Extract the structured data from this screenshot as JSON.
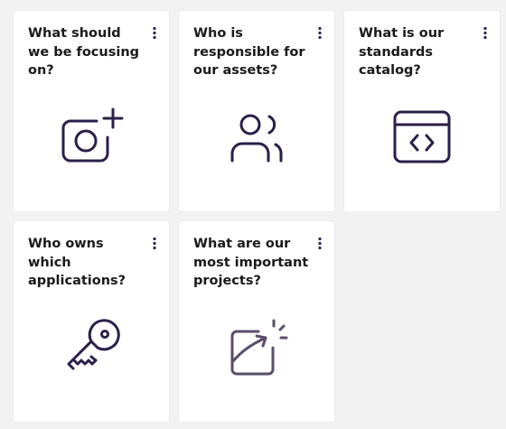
{
  "cards": [
    {
      "title": "What should we be focusing on?",
      "icon": "camera-plus-icon"
    },
    {
      "title": "Who is responsible for our assets?",
      "icon": "users-icon"
    },
    {
      "title": "What is our standards catalog?",
      "icon": "code-window-icon"
    },
    {
      "title": "Who owns which applications?",
      "icon": "key-icon"
    },
    {
      "title": "What are our most important projects?",
      "icon": "chart-spark-icon"
    }
  ],
  "colors": {
    "background": "#f2f2f2",
    "card": "#ffffff",
    "title_text": "#1a1a1a",
    "icon": "#2b1f4a",
    "icon_muted": "#5a4d6a"
  }
}
